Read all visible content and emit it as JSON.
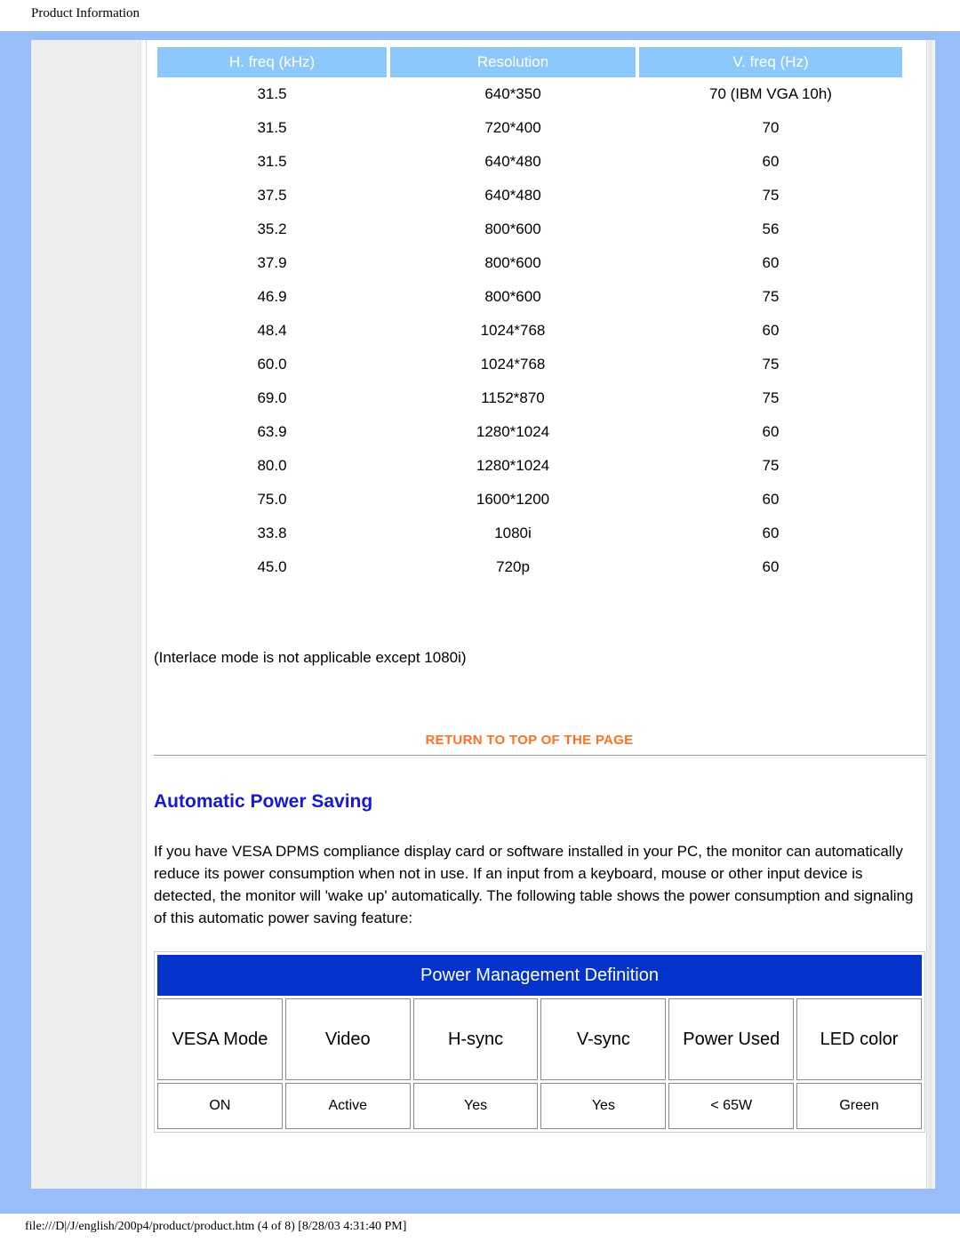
{
  "document": {
    "title": "Product Information",
    "status_bar": "file:///D|/J/english/200p4/product/product.htm (4 of 8) [8/28/03 4:31:40 PM]"
  },
  "colors": {
    "frame_blue": "#99bdfa",
    "table_header_blue": "#8cc8fc",
    "pm_title_blue": "#0433cc",
    "heading_blue": "#1818cf",
    "return_link_orange": "#ff7020",
    "nav_gray": "#eeeeee"
  },
  "timing_table": {
    "headers": [
      "H. freq (kHz)",
      "Resolution",
      "V. freq (Hz)"
    ],
    "rows": [
      [
        "31.5",
        "640*350",
        "70 (IBM VGA 10h)"
      ],
      [
        "31.5",
        "720*400",
        "70"
      ],
      [
        "31.5",
        "640*480",
        "60"
      ],
      [
        "37.5",
        "640*480",
        "75"
      ],
      [
        "35.2",
        "800*600",
        "56"
      ],
      [
        "37.9",
        "800*600",
        "60"
      ],
      [
        "46.9",
        "800*600",
        "75"
      ],
      [
        "48.4",
        "1024*768",
        "60"
      ],
      [
        "60.0",
        "1024*768",
        "75"
      ],
      [
        "69.0",
        "1152*870",
        "75"
      ],
      [
        "63.9",
        "1280*1024",
        "60"
      ],
      [
        "80.0",
        "1280*1024",
        "75"
      ],
      [
        "75.0",
        "1600*1200",
        "60"
      ],
      [
        "33.8",
        "1080i",
        "60"
      ],
      [
        "45.0",
        "720p",
        "60"
      ]
    ],
    "note": "(Interlace mode is not applicable except 1080i)"
  },
  "return_link": {
    "label": "RETURN TO TOP OF THE PAGE"
  },
  "power_saving": {
    "heading": "Automatic Power Saving",
    "paragraph": "If you have VESA DPMS compliance display card or software installed in your PC, the monitor can automatically reduce its power consumption when not in use. If an input from a keyboard, mouse or other input device is detected, the monitor will 'wake up' automatically. The following table shows the power consumption and signaling of this automatic power saving feature:"
  },
  "power_management_table": {
    "title": "Power Management Definition",
    "headers": [
      "VESA Mode",
      "Video",
      "H-sync",
      "V-sync",
      "Power Used",
      "LED color"
    ],
    "rows": [
      [
        "ON",
        "Active",
        "Yes",
        "Yes",
        "< 65W",
        "Green"
      ]
    ]
  }
}
